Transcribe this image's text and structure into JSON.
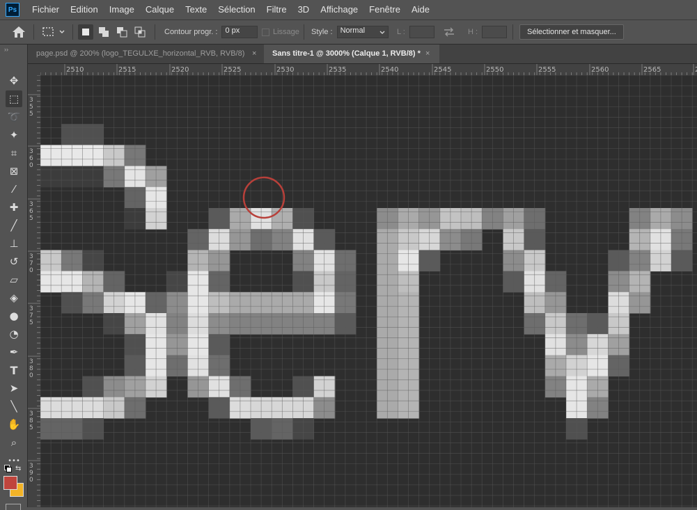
{
  "app": {
    "logo_text": "Ps"
  },
  "menu": [
    "Fichier",
    "Edition",
    "Image",
    "Calque",
    "Texte",
    "Sélection",
    "Filtre",
    "3D",
    "Affichage",
    "Fenêtre",
    "Aide"
  ],
  "options": {
    "contour_label": "Contour progr. :",
    "contour_value": "0 px",
    "lissage_label": "Lissage",
    "style_label": "Style :",
    "style_value": "Normal",
    "width_label": "L :",
    "height_label": "H :",
    "select_mask_label": "Sélectionner et masquer..."
  },
  "tabs": [
    {
      "label": "page.psd @ 200% (logo_TEGULXE_horizontal_RVB, RVB/8)",
      "close": "×",
      "active": false
    },
    {
      "label": "Sans titre-1 @ 3000% (Calque 1, RVB/8) *",
      "close": "×",
      "active": true
    }
  ],
  "tools": [
    "move-icon",
    "rectangular-marquee-icon",
    "lasso-icon",
    "magic-wand-icon",
    "crop-icon",
    "frame-icon",
    "eyedropper-icon",
    "healing-brush-icon",
    "brush-icon",
    "clone-stamp-icon",
    "history-brush-icon",
    "eraser-icon",
    "paint-bucket-icon",
    "blur-icon",
    "dodge-icon",
    "pen-icon",
    "type-icon",
    "path-selection-icon",
    "line-icon",
    "hand-icon",
    "zoom-icon",
    "more-tools-icon"
  ],
  "colors": {
    "foreground": "#c0453d",
    "background": "#f2b327",
    "marker": "#b8403a"
  },
  "ruler_top": [
    "2510",
    "2515",
    "2520",
    "2525",
    "2530",
    "2535",
    "2540",
    "2545",
    "2550",
    "2555",
    "2560",
    "2565",
    "2"
  ],
  "ruler_left": [
    "355",
    "360",
    "365",
    "370",
    "375",
    "380",
    "385",
    "390"
  ],
  "pixel_art": {
    "comment_grid": "each row lists [column, grey-level] cells; grey-level in 0-255",
    "cols": 32,
    "rows": 21,
    "cells": [
      [
        1,
        1,
        80
      ],
      [
        1,
        2,
        80
      ],
      [
        2,
        0,
        232
      ],
      [
        2,
        1,
        232
      ],
      [
        2,
        2,
        232
      ],
      [
        2,
        3,
        200
      ],
      [
        2,
        4,
        120
      ],
      [
        2,
        32,
        200
      ],
      [
        3,
        0,
        60
      ],
      [
        3,
        1,
        60
      ],
      [
        3,
        2,
        60
      ],
      [
        3,
        3,
        120
      ],
      [
        3,
        4,
        228
      ],
      [
        3,
        5,
        160
      ],
      [
        3,
        32,
        170
      ],
      [
        4,
        4,
        100
      ],
      [
        4,
        5,
        230
      ],
      [
        5,
        4,
        60
      ],
      [
        5,
        5,
        210
      ],
      [
        5,
        8,
        90
      ],
      [
        5,
        9,
        170
      ],
      [
        5,
        10,
        225
      ],
      [
        5,
        11,
        175
      ],
      [
        5,
        12,
        80
      ],
      [
        5,
        16,
        140
      ],
      [
        5,
        17,
        170
      ],
      [
        5,
        18,
        150
      ],
      [
        5,
        19,
        195
      ],
      [
        5,
        20,
        190
      ],
      [
        5,
        21,
        130
      ],
      [
        5,
        22,
        160
      ],
      [
        5,
        23,
        110
      ],
      [
        5,
        28,
        130
      ],
      [
        5,
        29,
        170
      ],
      [
        5,
        30,
        140
      ],
      [
        6,
        7,
        100
      ],
      [
        6,
        8,
        220
      ],
      [
        6,
        9,
        150
      ],
      [
        6,
        10,
        110
      ],
      [
        6,
        11,
        130
      ],
      [
        6,
        12,
        225
      ],
      [
        6,
        13,
        90
      ],
      [
        6,
        16,
        170
      ],
      [
        6,
        17,
        200
      ],
      [
        6,
        18,
        215
      ],
      [
        6,
        19,
        140
      ],
      [
        6,
        20,
        120
      ],
      [
        6,
        22,
        200
      ],
      [
        6,
        23,
        90
      ],
      [
        6,
        28,
        180
      ],
      [
        6,
        29,
        225
      ],
      [
        6,
        30,
        120
      ],
      [
        7,
        0,
        200
      ],
      [
        7,
        1,
        120
      ],
      [
        7,
        2,
        70
      ],
      [
        7,
        7,
        180
      ],
      [
        7,
        8,
        150
      ],
      [
        7,
        12,
        130
      ],
      [
        7,
        13,
        225
      ],
      [
        7,
        14,
        110
      ],
      [
        7,
        16,
        170
      ],
      [
        7,
        17,
        230
      ],
      [
        7,
        18,
        90
      ],
      [
        7,
        22,
        140
      ],
      [
        7,
        23,
        200
      ],
      [
        7,
        27,
        90
      ],
      [
        7,
        28,
        130
      ],
      [
        7,
        29,
        210
      ],
      [
        7,
        30,
        90
      ],
      [
        8,
        0,
        230
      ],
      [
        8,
        1,
        230
      ],
      [
        8,
        2,
        180
      ],
      [
        8,
        3,
        100
      ],
      [
        8,
        6,
        70
      ],
      [
        8,
        7,
        230
      ],
      [
        8,
        8,
        100
      ],
      [
        8,
        12,
        80
      ],
      [
        8,
        13,
        200
      ],
      [
        8,
        14,
        100
      ],
      [
        8,
        16,
        170
      ],
      [
        8,
        17,
        190
      ],
      [
        8,
        22,
        90
      ],
      [
        8,
        23,
        225
      ],
      [
        8,
        24,
        100
      ],
      [
        8,
        27,
        140
      ],
      [
        8,
        28,
        180
      ],
      [
        9,
        1,
        80
      ],
      [
        9,
        2,
        120
      ],
      [
        9,
        3,
        210
      ],
      [
        9,
        4,
        230
      ],
      [
        9,
        5,
        100
      ],
      [
        9,
        6,
        140
      ],
      [
        9,
        7,
        230
      ],
      [
        9,
        8,
        190
      ],
      [
        9,
        9,
        170
      ],
      [
        9,
        10,
        170
      ],
      [
        9,
        11,
        170
      ],
      [
        9,
        12,
        170
      ],
      [
        9,
        13,
        230
      ],
      [
        9,
        14,
        120
      ],
      [
        9,
        16,
        170
      ],
      [
        9,
        17,
        180
      ],
      [
        9,
        23,
        190
      ],
      [
        9,
        24,
        150
      ],
      [
        9,
        27,
        220
      ],
      [
        9,
        28,
        150
      ],
      [
        10,
        3,
        70
      ],
      [
        10,
        4,
        160
      ],
      [
        10,
        5,
        225
      ],
      [
        10,
        6,
        130
      ],
      [
        10,
        7,
        220
      ],
      [
        10,
        8,
        140
      ],
      [
        10,
        9,
        130
      ],
      [
        10,
        10,
        130
      ],
      [
        10,
        11,
        130
      ],
      [
        10,
        12,
        130
      ],
      [
        10,
        13,
        130
      ],
      [
        10,
        14,
        90
      ],
      [
        10,
        16,
        170
      ],
      [
        10,
        17,
        180
      ],
      [
        10,
        23,
        110
      ],
      [
        10,
        24,
        200
      ],
      [
        10,
        25,
        110
      ],
      [
        10,
        26,
        90
      ],
      [
        10,
        27,
        200
      ],
      [
        11,
        4,
        80
      ],
      [
        11,
        5,
        230
      ],
      [
        11,
        6,
        150
      ],
      [
        11,
        7,
        230
      ],
      [
        11,
        8,
        90
      ],
      [
        11,
        16,
        170
      ],
      [
        11,
        17,
        180
      ],
      [
        11,
        24,
        225
      ],
      [
        11,
        25,
        140
      ],
      [
        11,
        26,
        215
      ],
      [
        11,
        27,
        160
      ],
      [
        12,
        4,
        90
      ],
      [
        12,
        5,
        230
      ],
      [
        12,
        6,
        110
      ],
      [
        12,
        7,
        225
      ],
      [
        12,
        8,
        110
      ],
      [
        12,
        16,
        170
      ],
      [
        12,
        17,
        180
      ],
      [
        12,
        24,
        170
      ],
      [
        12,
        25,
        210
      ],
      [
        12,
        26,
        230
      ],
      [
        12,
        27,
        100
      ],
      [
        13,
        2,
        80
      ],
      [
        13,
        3,
        140
      ],
      [
        13,
        4,
        160
      ],
      [
        13,
        5,
        210
      ],
      [
        13,
        7,
        150
      ],
      [
        13,
        8,
        225
      ],
      [
        13,
        9,
        110
      ],
      [
        13,
        12,
        80
      ],
      [
        13,
        13,
        210
      ],
      [
        13,
        16,
        170
      ],
      [
        13,
        17,
        180
      ],
      [
        13,
        24,
        130
      ],
      [
        13,
        25,
        230
      ],
      [
        13,
        26,
        170
      ],
      [
        14,
        0,
        220
      ],
      [
        14,
        1,
        220
      ],
      [
        14,
        2,
        220
      ],
      [
        14,
        3,
        200
      ],
      [
        14,
        4,
        110
      ],
      [
        14,
        8,
        90
      ],
      [
        14,
        9,
        220
      ],
      [
        14,
        10,
        215
      ],
      [
        14,
        11,
        215
      ],
      [
        14,
        12,
        215
      ],
      [
        14,
        13,
        140
      ],
      [
        14,
        16,
        170
      ],
      [
        14,
        17,
        180
      ],
      [
        14,
        25,
        230
      ],
      [
        14,
        26,
        130
      ],
      [
        15,
        0,
        100
      ],
      [
        15,
        1,
        100
      ],
      [
        15,
        2,
        80
      ],
      [
        15,
        10,
        90
      ],
      [
        15,
        11,
        100
      ],
      [
        15,
        12,
        70
      ],
      [
        15,
        25,
        80
      ]
    ]
  }
}
